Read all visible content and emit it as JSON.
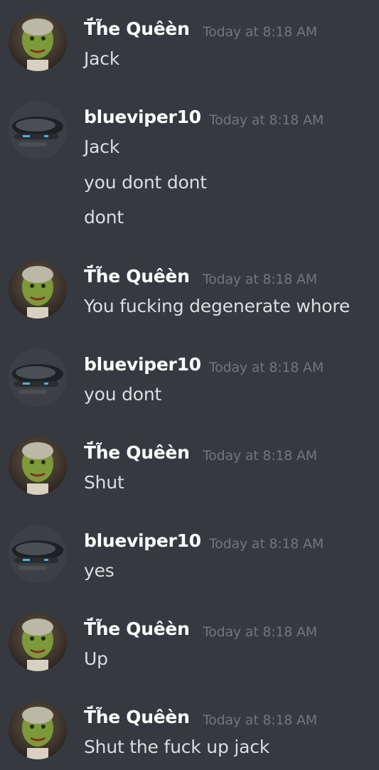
{
  "messages": [
    {
      "author": "T̈́h̃e Quêèn",
      "timestamp": "Today at 8:18 AM",
      "lines": [
        "Jack"
      ]
    },
    {
      "author": "blueviper10",
      "timestamp": "Today at 8:18 AM",
      "lines": [
        "Jack",
        "you dont dont",
        "dont"
      ]
    },
    {
      "author": "T̈́h̃e Quêèn",
      "timestamp": "Today at 8:18 AM",
      "lines": [
        "You fucking degenerate whore"
      ]
    },
    {
      "author": "blueviper10",
      "timestamp": "Today at 8:18 AM",
      "lines": [
        "you dont"
      ]
    },
    {
      "author": "T̈́h̃e Quêèn",
      "timestamp": "Today at 8:18 AM",
      "lines": [
        "Shut"
      ]
    },
    {
      "author": "blueviper10",
      "timestamp": "Today at 8:18 AM",
      "lines": [
        "yes"
      ]
    },
    {
      "author": "T̈́h̃e Quêèn",
      "timestamp": "Today at 8:18 AM",
      "lines": [
        "Up"
      ]
    },
    {
      "author": "T̈́h̃e Quêèn",
      "timestamp": "Today at 8:18 AM",
      "lines": [
        "Shut the fuck up jack"
      ]
    }
  ],
  "colors": {
    "background": "#36393f",
    "username": "#ffffff",
    "timestamp": "#72767d",
    "message_text": "#dcddde"
  },
  "icons": {
    "queen_avatar": "queen-lizard-avatar-icon",
    "blue_avatar": "spaceship-avatar-icon"
  }
}
